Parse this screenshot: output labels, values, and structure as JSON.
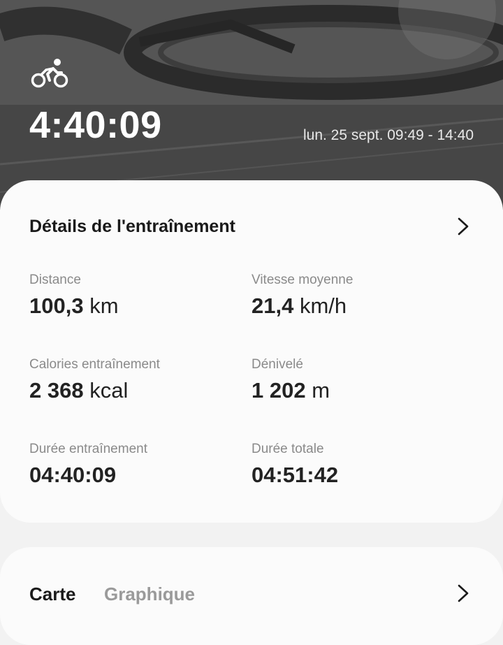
{
  "header": {
    "activity_icon": "cycling-icon",
    "elapsed_time": "4:40:09",
    "date_range": "lun. 25 sept. 09:49 - 14:40"
  },
  "details": {
    "title": "Détails de l'entraînement",
    "stats": [
      {
        "label": "Distance",
        "value": "100,3",
        "unit": "km"
      },
      {
        "label": "Vitesse moyenne",
        "value": "21,4",
        "unit": "km/h"
      },
      {
        "label": "Calories entraînement",
        "value": "2 368",
        "unit": "kcal"
      },
      {
        "label": "Dénivelé",
        "value": "1 202",
        "unit": "m"
      },
      {
        "label": "Durée entraînement",
        "value": "04:40:09",
        "unit": ""
      },
      {
        "label": "Durée totale",
        "value": "04:51:42",
        "unit": ""
      }
    ]
  },
  "map_section": {
    "tabs": [
      {
        "label": "Carte",
        "active": true
      },
      {
        "label": "Graphique",
        "active": false
      }
    ]
  },
  "colors": {
    "card_background": "#fbfbfb",
    "page_background": "#f2f2f2",
    "title_text": "#1a1a1a",
    "label_text": "#8a8a8a",
    "inactive_tab": "#9a9a9a"
  }
}
